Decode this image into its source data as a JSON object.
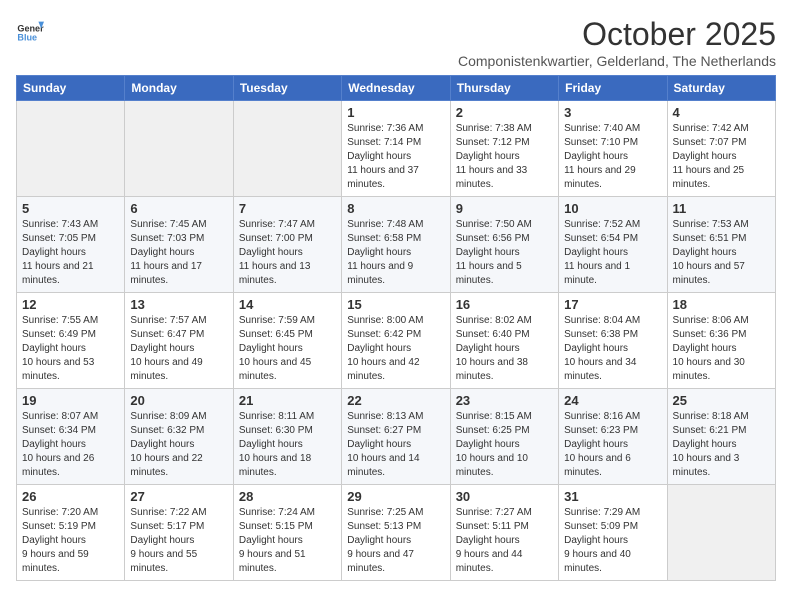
{
  "logo": {
    "line1": "General",
    "line2": "Blue"
  },
  "title": "October 2025",
  "subtitle": "Componistenkwartier, Gelderland, The Netherlands",
  "days_of_week": [
    "Sunday",
    "Monday",
    "Tuesday",
    "Wednesday",
    "Thursday",
    "Friday",
    "Saturday"
  ],
  "weeks": [
    [
      {
        "day": "",
        "empty": true
      },
      {
        "day": "",
        "empty": true
      },
      {
        "day": "",
        "empty": true
      },
      {
        "day": "1",
        "sunrise": "7:36 AM",
        "sunset": "7:14 PM",
        "daylight": "11 hours and 37 minutes."
      },
      {
        "day": "2",
        "sunrise": "7:38 AM",
        "sunset": "7:12 PM",
        "daylight": "11 hours and 33 minutes."
      },
      {
        "day": "3",
        "sunrise": "7:40 AM",
        "sunset": "7:10 PM",
        "daylight": "11 hours and 29 minutes."
      },
      {
        "day": "4",
        "sunrise": "7:42 AM",
        "sunset": "7:07 PM",
        "daylight": "11 hours and 25 minutes."
      }
    ],
    [
      {
        "day": "5",
        "sunrise": "7:43 AM",
        "sunset": "7:05 PM",
        "daylight": "11 hours and 21 minutes."
      },
      {
        "day": "6",
        "sunrise": "7:45 AM",
        "sunset": "7:03 PM",
        "daylight": "11 hours and 17 minutes."
      },
      {
        "day": "7",
        "sunrise": "7:47 AM",
        "sunset": "7:00 PM",
        "daylight": "11 hours and 13 minutes."
      },
      {
        "day": "8",
        "sunrise": "7:48 AM",
        "sunset": "6:58 PM",
        "daylight": "11 hours and 9 minutes."
      },
      {
        "day": "9",
        "sunrise": "7:50 AM",
        "sunset": "6:56 PM",
        "daylight": "11 hours and 5 minutes."
      },
      {
        "day": "10",
        "sunrise": "7:52 AM",
        "sunset": "6:54 PM",
        "daylight": "11 hours and 1 minute."
      },
      {
        "day": "11",
        "sunrise": "7:53 AM",
        "sunset": "6:51 PM",
        "daylight": "10 hours and 57 minutes."
      }
    ],
    [
      {
        "day": "12",
        "sunrise": "7:55 AM",
        "sunset": "6:49 PM",
        "daylight": "10 hours and 53 minutes."
      },
      {
        "day": "13",
        "sunrise": "7:57 AM",
        "sunset": "6:47 PM",
        "daylight": "10 hours and 49 minutes."
      },
      {
        "day": "14",
        "sunrise": "7:59 AM",
        "sunset": "6:45 PM",
        "daylight": "10 hours and 45 minutes."
      },
      {
        "day": "15",
        "sunrise": "8:00 AM",
        "sunset": "6:42 PM",
        "daylight": "10 hours and 42 minutes."
      },
      {
        "day": "16",
        "sunrise": "8:02 AM",
        "sunset": "6:40 PM",
        "daylight": "10 hours and 38 minutes."
      },
      {
        "day": "17",
        "sunrise": "8:04 AM",
        "sunset": "6:38 PM",
        "daylight": "10 hours and 34 minutes."
      },
      {
        "day": "18",
        "sunrise": "8:06 AM",
        "sunset": "6:36 PM",
        "daylight": "10 hours and 30 minutes."
      }
    ],
    [
      {
        "day": "19",
        "sunrise": "8:07 AM",
        "sunset": "6:34 PM",
        "daylight": "10 hours and 26 minutes."
      },
      {
        "day": "20",
        "sunrise": "8:09 AM",
        "sunset": "6:32 PM",
        "daylight": "10 hours and 22 minutes."
      },
      {
        "day": "21",
        "sunrise": "8:11 AM",
        "sunset": "6:30 PM",
        "daylight": "10 hours and 18 minutes."
      },
      {
        "day": "22",
        "sunrise": "8:13 AM",
        "sunset": "6:27 PM",
        "daylight": "10 hours and 14 minutes."
      },
      {
        "day": "23",
        "sunrise": "8:15 AM",
        "sunset": "6:25 PM",
        "daylight": "10 hours and 10 minutes."
      },
      {
        "day": "24",
        "sunrise": "8:16 AM",
        "sunset": "6:23 PM",
        "daylight": "10 hours and 6 minutes."
      },
      {
        "day": "25",
        "sunrise": "8:18 AM",
        "sunset": "6:21 PM",
        "daylight": "10 hours and 3 minutes."
      }
    ],
    [
      {
        "day": "26",
        "sunrise": "7:20 AM",
        "sunset": "5:19 PM",
        "daylight": "9 hours and 59 minutes."
      },
      {
        "day": "27",
        "sunrise": "7:22 AM",
        "sunset": "5:17 PM",
        "daylight": "9 hours and 55 minutes."
      },
      {
        "day": "28",
        "sunrise": "7:24 AM",
        "sunset": "5:15 PM",
        "daylight": "9 hours and 51 minutes."
      },
      {
        "day": "29",
        "sunrise": "7:25 AM",
        "sunset": "5:13 PM",
        "daylight": "9 hours and 47 minutes."
      },
      {
        "day": "30",
        "sunrise": "7:27 AM",
        "sunset": "5:11 PM",
        "daylight": "9 hours and 44 minutes."
      },
      {
        "day": "31",
        "sunrise": "7:29 AM",
        "sunset": "5:09 PM",
        "daylight": "9 hours and 40 minutes."
      },
      {
        "day": "",
        "empty": true
      }
    ]
  ]
}
